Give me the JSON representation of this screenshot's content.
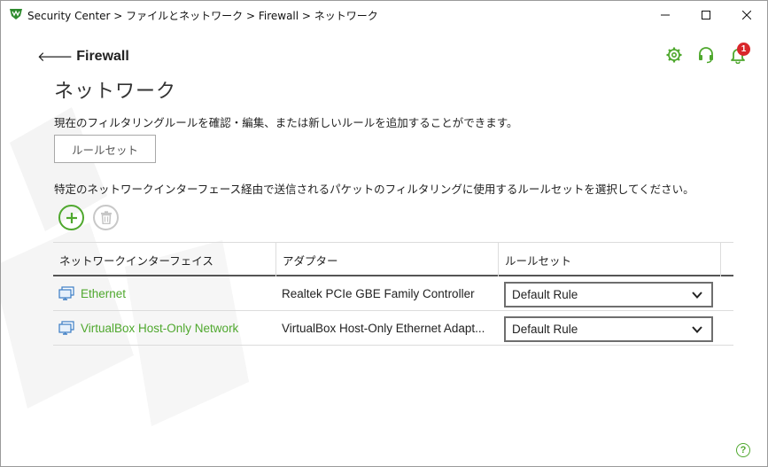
{
  "titlebar": {
    "breadcrumb": "Security Center > ファイルとネットワーク > Firewall > ネットワーク",
    "minimize_icon": "minimize-icon",
    "maximize_icon": "maximize-icon",
    "close_icon": "close-icon"
  },
  "header": {
    "back_arrow": "🡐",
    "back_label": "Firewall",
    "title": "ネットワーク",
    "notification_count": "1"
  },
  "main": {
    "description_1": "現在のフィルタリングルールを確認・編集、または新しいルールを追加することができます。",
    "ruleset_button": "ルールセット",
    "description_2": "特定のネットワークインターフェース経由で送信されるパケットのフィルタリングに使用するルールセットを選択してください。"
  },
  "table": {
    "columns": [
      "ネットワークインターフェイス",
      "アダプター",
      "ルールセット"
    ],
    "rows": [
      {
        "interface": "Ethernet",
        "adapter": "Realtek PCIe GBE Family Controller",
        "ruleset": "Default Rule"
      },
      {
        "interface": "VirtualBox Host-Only Network",
        "adapter": "VirtualBox Host-Only Ethernet Adapt...",
        "ruleset": "Default Rule"
      }
    ]
  },
  "help_label": "?",
  "colors": {
    "accent": "#4fa82e",
    "badge": "#d9262b"
  }
}
